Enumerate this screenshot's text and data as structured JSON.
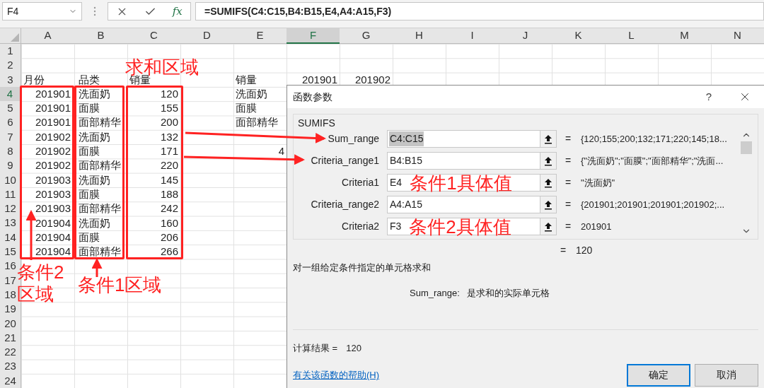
{
  "name_box": "F4",
  "formula_bar": {
    "function_icon": "fx",
    "formula": "=SUMIFS(C4:C15,B4:B15,E4,A4:A15,F3)"
  },
  "columns": [
    {
      "label": "A",
      "selected": false
    },
    {
      "label": "B",
      "selected": false
    },
    {
      "label": "C",
      "selected": false
    },
    {
      "label": "D",
      "selected": false
    },
    {
      "label": "E",
      "selected": false
    },
    {
      "label": "F",
      "selected": true
    },
    {
      "label": "G",
      "selected": false
    },
    {
      "label": "H",
      "selected": false
    },
    {
      "label": "I",
      "selected": false
    },
    {
      "label": "J",
      "selected": false
    },
    {
      "label": "K",
      "selected": false
    },
    {
      "label": "L",
      "selected": false
    },
    {
      "label": "M",
      "selected": false
    },
    {
      "label": "N",
      "selected": false
    }
  ],
  "rows": [
    {
      "label": "1",
      "selected": false,
      "cells": {}
    },
    {
      "label": "2",
      "selected": false,
      "cells": {}
    },
    {
      "label": "3",
      "selected": false,
      "cells": {
        "A": {
          "text": "月份",
          "kind": "text"
        },
        "B": {
          "text": "品类",
          "kind": "text"
        },
        "C": {
          "text": "销量",
          "kind": "text"
        },
        "E": {
          "text": "销量",
          "kind": "text"
        },
        "F": {
          "text": "201901",
          "kind": "number"
        },
        "G": {
          "text": "201902",
          "kind": "number"
        }
      }
    },
    {
      "label": "4",
      "selected": true,
      "cells": {
        "A": {
          "text": "201901",
          "kind": "number"
        },
        "B": {
          "text": "洗面奶",
          "kind": "text"
        },
        "C": {
          "text": "120",
          "kind": "number"
        },
        "E": {
          "text": "洗面奶",
          "kind": "text"
        }
      }
    },
    {
      "label": "5",
      "selected": false,
      "cells": {
        "A": {
          "text": "201901",
          "kind": "number"
        },
        "B": {
          "text": "面膜",
          "kind": "text"
        },
        "C": {
          "text": "155",
          "kind": "number"
        },
        "E": {
          "text": "面膜",
          "kind": "text"
        }
      }
    },
    {
      "label": "6",
      "selected": false,
      "cells": {
        "A": {
          "text": "201901",
          "kind": "number"
        },
        "B": {
          "text": "面部精华",
          "kind": "text"
        },
        "C": {
          "text": "200",
          "kind": "number"
        },
        "E": {
          "text": "面部精华",
          "kind": "text"
        }
      }
    },
    {
      "label": "7",
      "selected": false,
      "cells": {
        "A": {
          "text": "201902",
          "kind": "number"
        },
        "B": {
          "text": "洗面奶",
          "kind": "text"
        },
        "C": {
          "text": "132",
          "kind": "number"
        }
      }
    },
    {
      "label": "8",
      "selected": false,
      "cells": {
        "A": {
          "text": "201902",
          "kind": "number"
        },
        "B": {
          "text": "面膜",
          "kind": "text"
        },
        "C": {
          "text": "171",
          "kind": "number"
        },
        "E": {
          "text": "4",
          "kind": "number"
        }
      }
    },
    {
      "label": "9",
      "selected": false,
      "cells": {
        "A": {
          "text": "201902",
          "kind": "number"
        },
        "B": {
          "text": "面部精华",
          "kind": "text"
        },
        "C": {
          "text": "220",
          "kind": "number"
        }
      }
    },
    {
      "label": "10",
      "selected": false,
      "cells": {
        "A": {
          "text": "201903",
          "kind": "number"
        },
        "B": {
          "text": "洗面奶",
          "kind": "text"
        },
        "C": {
          "text": "145",
          "kind": "number"
        }
      }
    },
    {
      "label": "11",
      "selected": false,
      "cells": {
        "A": {
          "text": "201903",
          "kind": "number"
        },
        "B": {
          "text": "面膜",
          "kind": "text"
        },
        "C": {
          "text": "188",
          "kind": "number"
        }
      }
    },
    {
      "label": "12",
      "selected": false,
      "cells": {
        "A": {
          "text": "201903",
          "kind": "number"
        },
        "B": {
          "text": "面部精华",
          "kind": "text"
        },
        "C": {
          "text": "242",
          "kind": "number"
        }
      }
    },
    {
      "label": "13",
      "selected": false,
      "cells": {
        "A": {
          "text": "201904",
          "kind": "number"
        },
        "B": {
          "text": "洗面奶",
          "kind": "text"
        },
        "C": {
          "text": "160",
          "kind": "number"
        }
      }
    },
    {
      "label": "14",
      "selected": false,
      "cells": {
        "A": {
          "text": "201904",
          "kind": "number"
        },
        "B": {
          "text": "面膜",
          "kind": "text"
        },
        "C": {
          "text": "206",
          "kind": "number"
        }
      }
    },
    {
      "label": "15",
      "selected": false,
      "cells": {
        "A": {
          "text": "201904",
          "kind": "number"
        },
        "B": {
          "text": "面部精华",
          "kind": "text"
        },
        "C": {
          "text": "266",
          "kind": "number"
        }
      }
    },
    {
      "label": "16",
      "selected": false,
      "cells": {}
    },
    {
      "label": "17",
      "selected": false,
      "cells": {}
    },
    {
      "label": "18",
      "selected": false,
      "cells": {}
    },
    {
      "label": "19",
      "selected": false,
      "cells": {}
    },
    {
      "label": "20",
      "selected": false,
      "cells": {}
    },
    {
      "label": "21",
      "selected": false,
      "cells": {}
    },
    {
      "label": "22",
      "selected": false,
      "cells": {}
    },
    {
      "label": "23",
      "selected": false,
      "cells": {}
    },
    {
      "label": "24",
      "selected": false,
      "cells": {}
    }
  ],
  "dialog": {
    "title": "函数参数",
    "help": "?",
    "function_name": "SUMIFS",
    "parameters": [
      {
        "label": "Sum_range",
        "value": "C4:C15",
        "text_selected": true,
        "equals": "=",
        "result": "{120;155;200;132;171;220;145;18..."
      },
      {
        "label": "Criteria_range1",
        "value": "B4:B15",
        "text_selected": false,
        "equals": "=",
        "result": "{\"洗面奶\";\"面膜\";\"面部精华\";\"洗面..."
      },
      {
        "label": "Criteria1",
        "value": "E4",
        "text_selected": false,
        "annotation": "条件1具体值",
        "equals": "=",
        "result": "\"洗面奶\""
      },
      {
        "label": "Criteria_range2",
        "value": "A4:A15",
        "text_selected": false,
        "equals": "=",
        "result": "{201901;201901;201901;201902;..."
      },
      {
        "label": "Criteria2",
        "value": "F3",
        "text_selected": false,
        "annotation": "条件2具体值",
        "equals": "=",
        "result": "201901"
      }
    ],
    "formula_result": {
      "equals": "=",
      "value": "120"
    },
    "description": "对一组给定条件指定的单元格求和",
    "argument_help": {
      "name": "Sum_range:",
      "text": "是求和的实际单元格"
    },
    "calc_result": {
      "label": "计算结果 =",
      "value": "120"
    },
    "help_link": "有关该函数的帮助(H)",
    "buttons": [
      {
        "label": "确定",
        "default": true
      },
      {
        "label": "取消",
        "default": false
      }
    ]
  },
  "annotations": [
    "求和区域",
    "条件2\n区域",
    "条件1区域"
  ]
}
